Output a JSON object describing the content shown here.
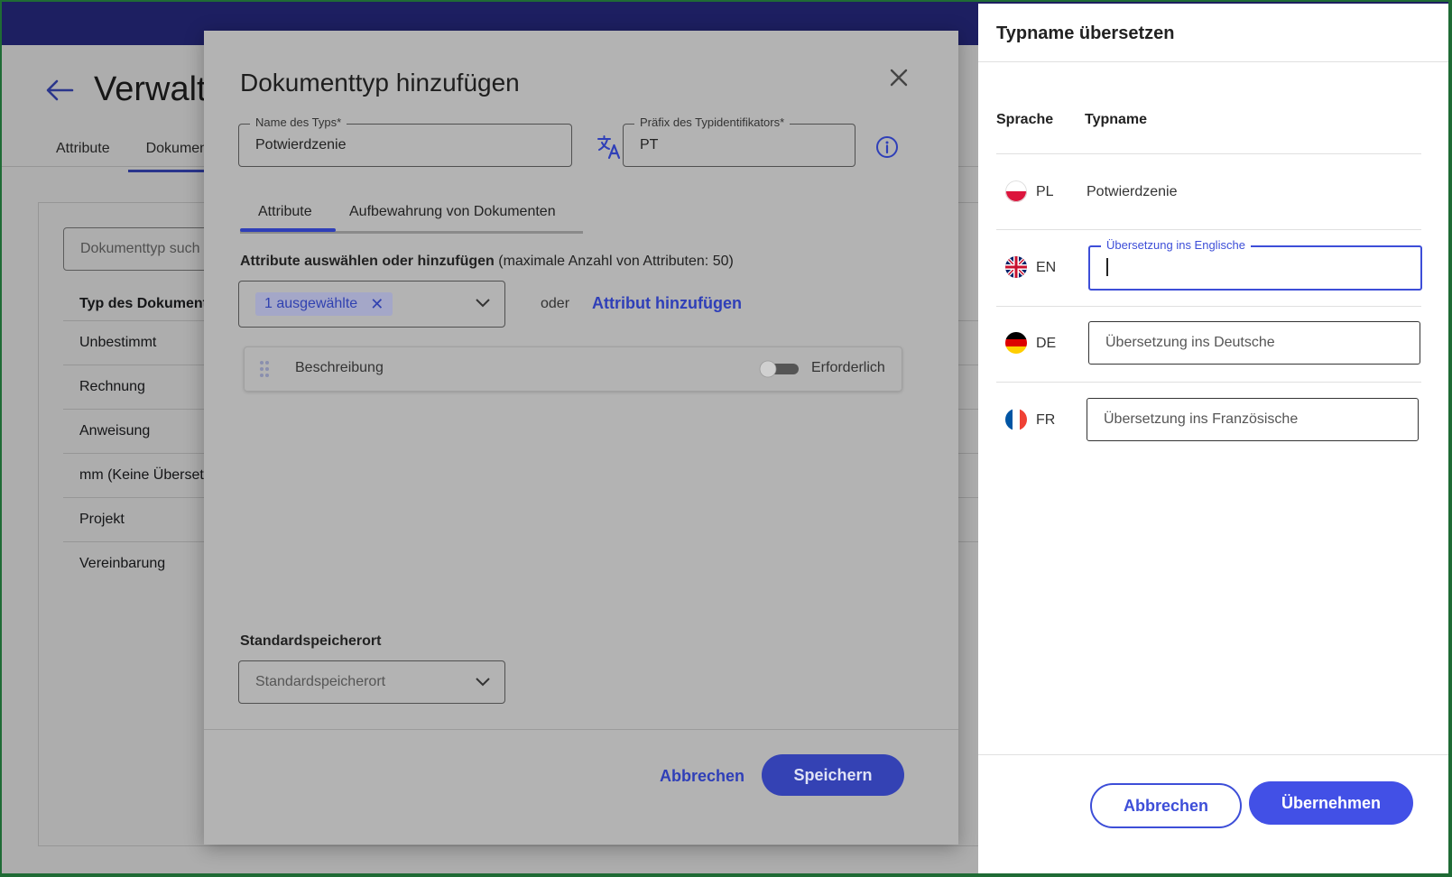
{
  "background_page": {
    "title": "Verwalt",
    "tabs": [
      "Attribute",
      "Dokumen"
    ],
    "search_placeholder": "Dokumenttyp such",
    "list_header": "Typ des Dokuments",
    "list_items": [
      "Unbestimmt",
      "Rechnung",
      "Anweisung",
      "mm (Keine Überset",
      "Projekt",
      "Vereinbarung"
    ]
  },
  "dialog": {
    "title": "Dokumenttyp hinzufügen",
    "type_name_label": "Name des Typs*",
    "type_name_value": "Potwierdzenie",
    "prefix_label": "Präfix des Typidentifikators*",
    "prefix_value": "PT",
    "tabs": [
      "Attribute",
      "Aufbewahrung von Dokumenten"
    ],
    "attributes_heading_bold": "Attribute auswählen oder hinzufügen",
    "attributes_heading_note": "(maximale Anzahl von Attributen: 50)",
    "selected_chip": "1 ausgewählte",
    "or_text": "oder",
    "add_attribute_link": "Attribut hinzufügen",
    "attribute_row": {
      "name": "Beschreibung",
      "required_label": "Erforderlich",
      "required": false
    },
    "storage_heading": "Standardspeicherort",
    "storage_placeholder": "Standardspeicherort",
    "cancel_label": "Abbrechen",
    "save_label": "Speichern"
  },
  "translate_panel": {
    "title": "Typname übersetzen",
    "col_language": "Sprache",
    "col_typename": "Typname",
    "rows": [
      {
        "code": "PL",
        "value": "Potwierdzenie"
      },
      {
        "code": "EN",
        "label": "Übersetzung ins Englische",
        "value": ""
      },
      {
        "code": "DE",
        "placeholder": "Übersetzung ins Deutsche"
      },
      {
        "code": "FR",
        "placeholder": "Übersetzung ins Französische"
      }
    ],
    "cancel_label": "Abbrechen",
    "apply_label": "Übernehmen"
  }
}
